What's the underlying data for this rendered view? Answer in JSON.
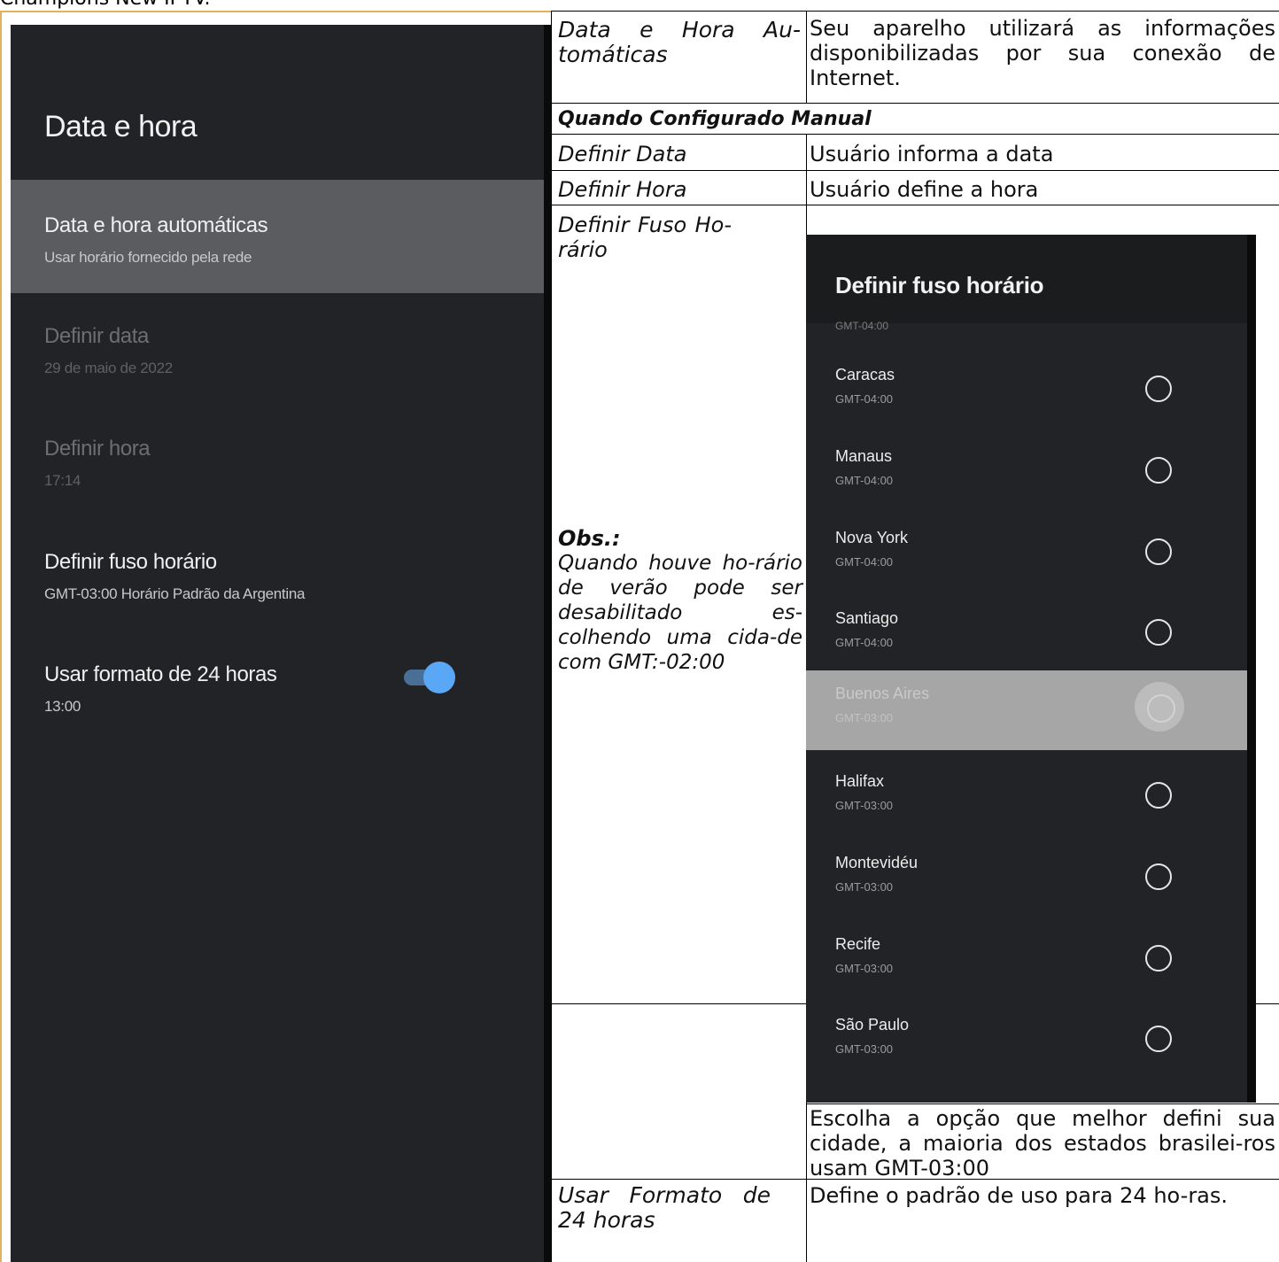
{
  "page_title_fragment": "Champions New IPTV.",
  "tv_settings": {
    "title": "Data e hora",
    "items": [
      {
        "title": "Data e hora automáticas",
        "subtitle": "Usar horário fornecido pela rede"
      },
      {
        "title": "Definir data",
        "subtitle": "29 de maio de 2022"
      },
      {
        "title": "Definir hora",
        "subtitle": "17:14"
      },
      {
        "title": "Definir fuso horário",
        "subtitle": "GMT-03:00 Horário Padrão da Argentina"
      },
      {
        "title": "Usar formato de 24 horas",
        "subtitle": "13:00"
      }
    ],
    "toggle_24h": "on"
  },
  "table": {
    "rows": [
      {
        "label": "Data e Hora Au-tomáticas",
        "desc": "Seu aparelho utilizará as informações disponibilizadas por sua conexão de Internet."
      },
      {
        "section": "Quando Configurado Manual"
      },
      {
        "label": "Definir Data",
        "desc": "Usuário informa a data"
      },
      {
        "label": "Definir Hora",
        "desc": "Usuário define a hora"
      },
      {
        "label": "Definir Fuso Ho-rário",
        "obs_title": "Obs.:",
        "obs_text": "Quando houve ho-rário de verão pode ser desabilitado es-colhendo uma cida-de com GMT:-02:00",
        "desc": "Escolha a opção que melhor defini sua cidade, a maioria dos estados brasilei-ros usam GMT-03:00"
      },
      {
        "label": "Usar Formato de 24 horas",
        "desc": "Define o padrão de uso para 24 ho-ras."
      }
    ]
  },
  "timezone_dialog": {
    "title": "Definir fuso horário",
    "peek_top": "GMT-04:00",
    "selected": "Buenos Aires",
    "zones": [
      {
        "city": "Caracas",
        "gmt": "GMT-04:00"
      },
      {
        "city": "Manaus",
        "gmt": "GMT-04:00"
      },
      {
        "city": "Nova York",
        "gmt": "GMT-04:00"
      },
      {
        "city": "Santiago",
        "gmt": "GMT-04:00"
      },
      {
        "city": "Buenos Aires",
        "gmt": "GMT-03:00"
      },
      {
        "city": "Halifax",
        "gmt": "GMT-03:00"
      },
      {
        "city": "Montevidéu",
        "gmt": "GMT-03:00"
      },
      {
        "city": "Recife",
        "gmt": "GMT-03:00"
      },
      {
        "city": "São Paulo",
        "gmt": "GMT-03:00"
      }
    ]
  }
}
